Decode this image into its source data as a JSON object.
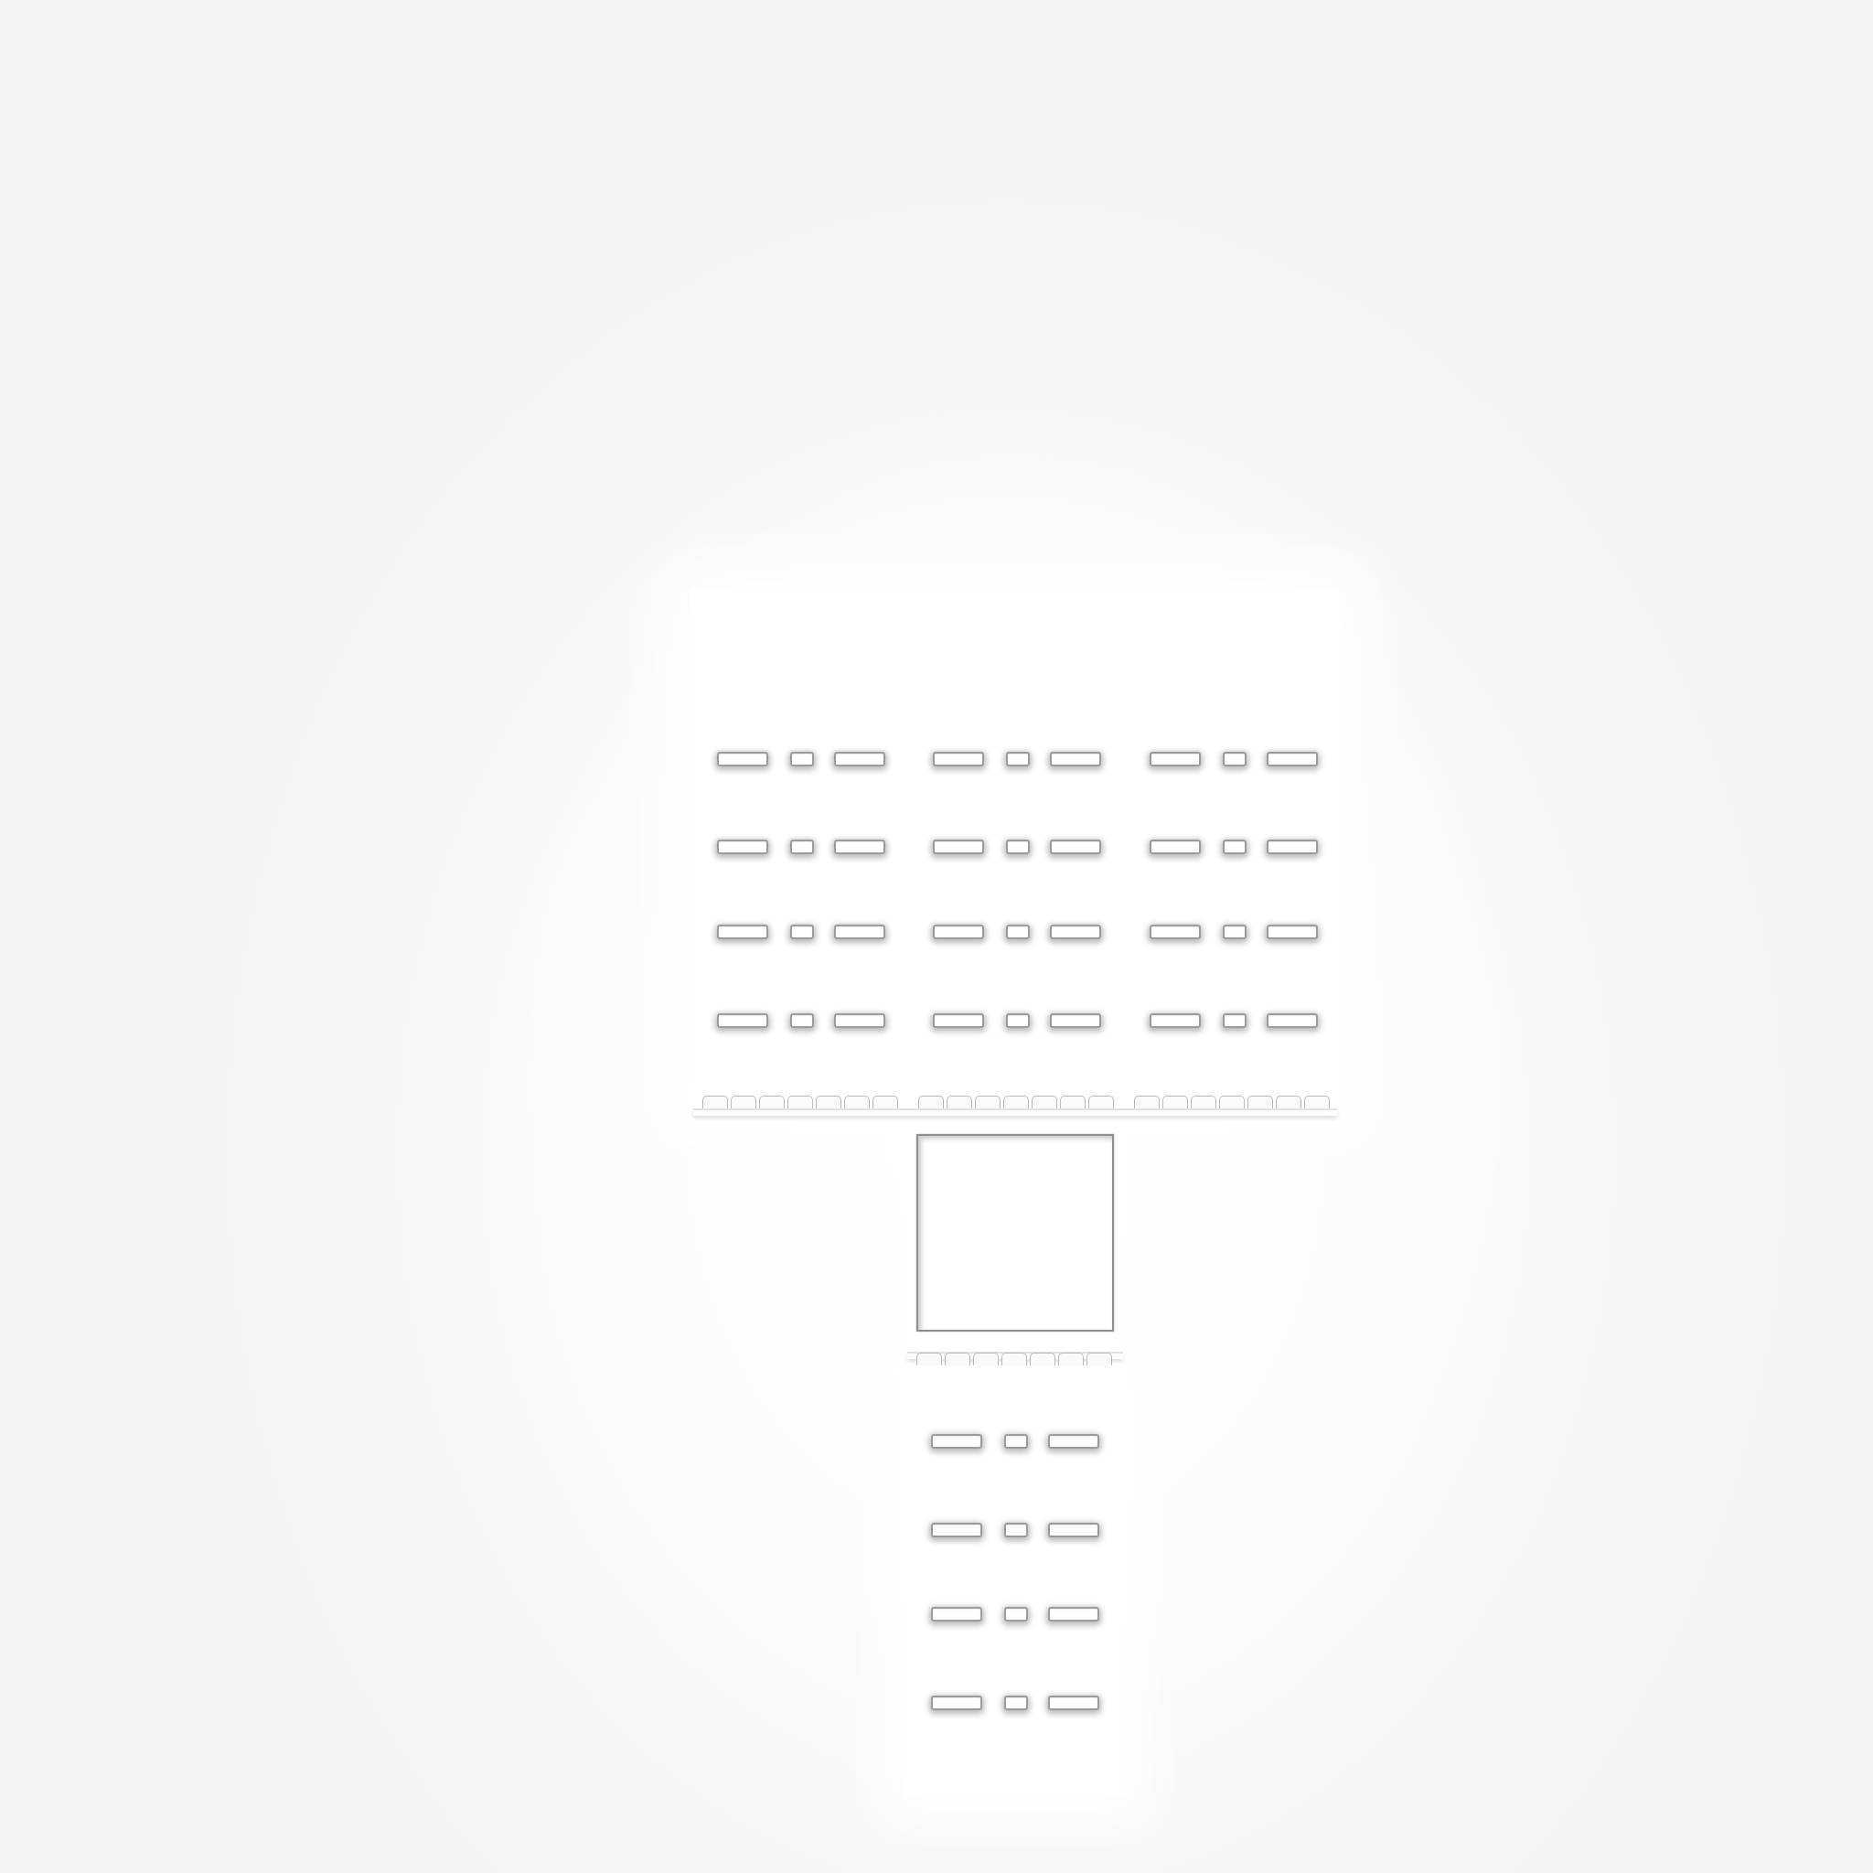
{
  "scene": {
    "background": "#f4f4f4",
    "surface": "#ffffff",
    "slot_outline": "#9c9c9c",
    "upper_block": {
      "columns": 3,
      "rows": 4,
      "pattern_per_group": [
        "long",
        "short",
        "long"
      ]
    },
    "lower_block": {
      "columns": 1,
      "rows": 4,
      "pattern_per_group": [
        "long",
        "short",
        "long"
      ]
    },
    "upper_ledge_teeth": 21,
    "middle_ledge_teeth": 7,
    "square_window": 1
  }
}
